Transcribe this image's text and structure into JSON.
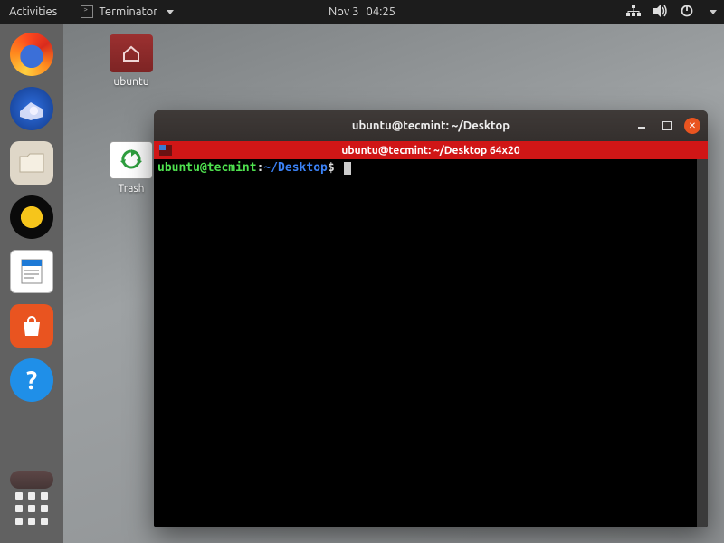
{
  "topbar": {
    "activities": "Activities",
    "app_name": "Terminator",
    "date": "Nov 3",
    "time": "04:25"
  },
  "desktop_icons": {
    "home_label": "ubuntu",
    "trash_label": "Trash"
  },
  "dock": {
    "items": [
      "firefox",
      "thunderbird",
      "files",
      "rhythmbox",
      "libreoffice-writer",
      "software-center",
      "help"
    ]
  },
  "window": {
    "title": "ubuntu@tecmint: ~/Desktop",
    "strip_text": "ubuntu@tecmint: ~/Desktop 64x20",
    "prompt_user": "ubuntu@tecmint",
    "prompt_sep": ":",
    "prompt_path": "~/Desktop",
    "prompt_dollar": "$"
  }
}
